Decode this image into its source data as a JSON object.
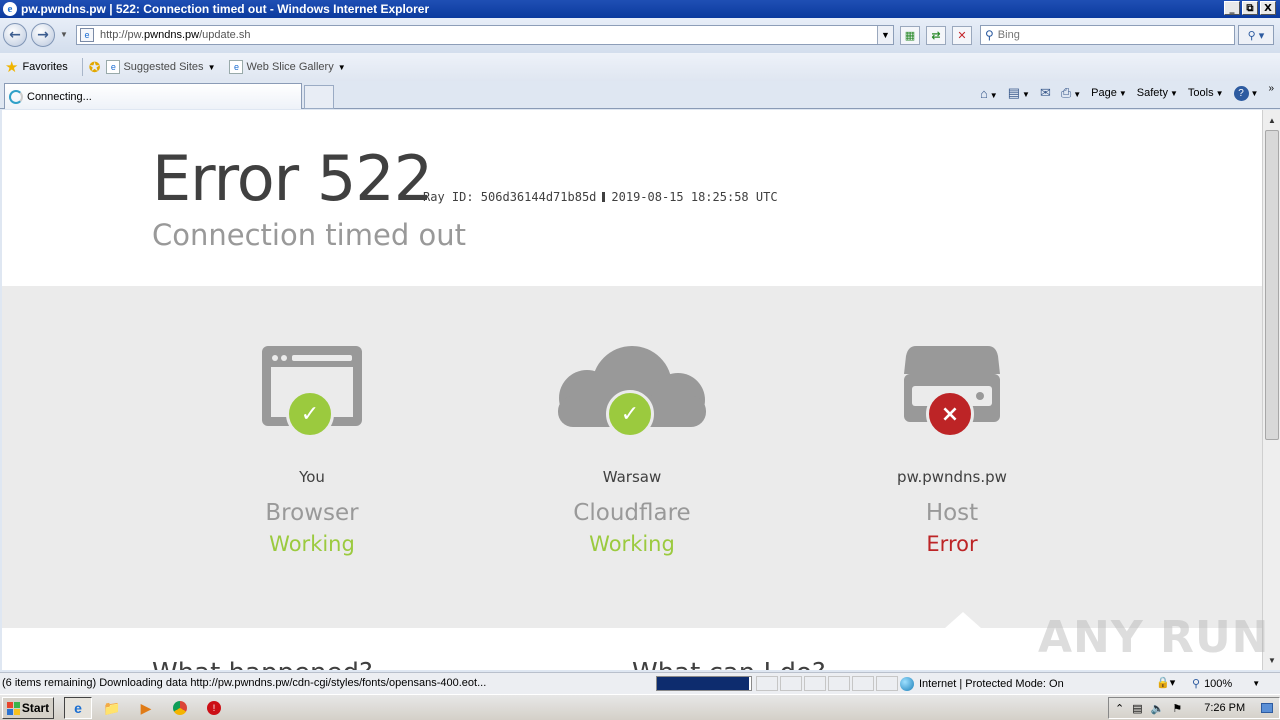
{
  "window": {
    "title": "pw.pwndns.pw | 522: Connection timed out - Windows Internet Explorer",
    "buttons": [
      "_",
      "⧉",
      "X"
    ]
  },
  "address": {
    "url_prefix": "http://pw.",
    "url_domain": "pwndns.pw",
    "url_path": "/update.sh",
    "search_placeholder": "Bing"
  },
  "favorites": {
    "label": "Favorites",
    "items": [
      "Suggested Sites",
      "Web Slice Gallery"
    ]
  },
  "tabs": [
    {
      "label": "Connecting..."
    }
  ],
  "commandbar": {
    "page": "Page",
    "safety": "Safety",
    "tools": "Tools"
  },
  "error": {
    "code": "Error 522",
    "ray_label": "Ray ID: 506d36144d71b85d",
    "timestamp": "2019-08-15 18:25:58 UTC",
    "subtitle": "Connection timed out"
  },
  "nodes": [
    {
      "location": "You",
      "role": "Browser",
      "state": "Working",
      "state_color": "#9bca3e",
      "badge": "✓"
    },
    {
      "location": "Warsaw",
      "role": "Cloudflare",
      "state": "Working",
      "state_color": "#9bca3e",
      "badge": "✓"
    },
    {
      "location": "pw.pwndns.pw",
      "role": "Host",
      "state": "Error",
      "state_color": "#bd2426",
      "badge": "×"
    }
  ],
  "below": {
    "left": "What happened?",
    "right": "What can I do?"
  },
  "statusbar": {
    "text": "(6 items remaining) Downloading data http://pw.pwndns.pw/cdn-cgi/styles/fonts/opensans-400.eot...",
    "progress": 0.98,
    "zone": "Internet | Protected Mode: On",
    "zoom": "100%"
  },
  "taskbar": {
    "start": "Start",
    "clock": "7:26 PM"
  },
  "watermark": "ANY RUN",
  "colors": {
    "working": "#9bca3e",
    "error": "#bd2426",
    "icon_gray": "#999999"
  }
}
